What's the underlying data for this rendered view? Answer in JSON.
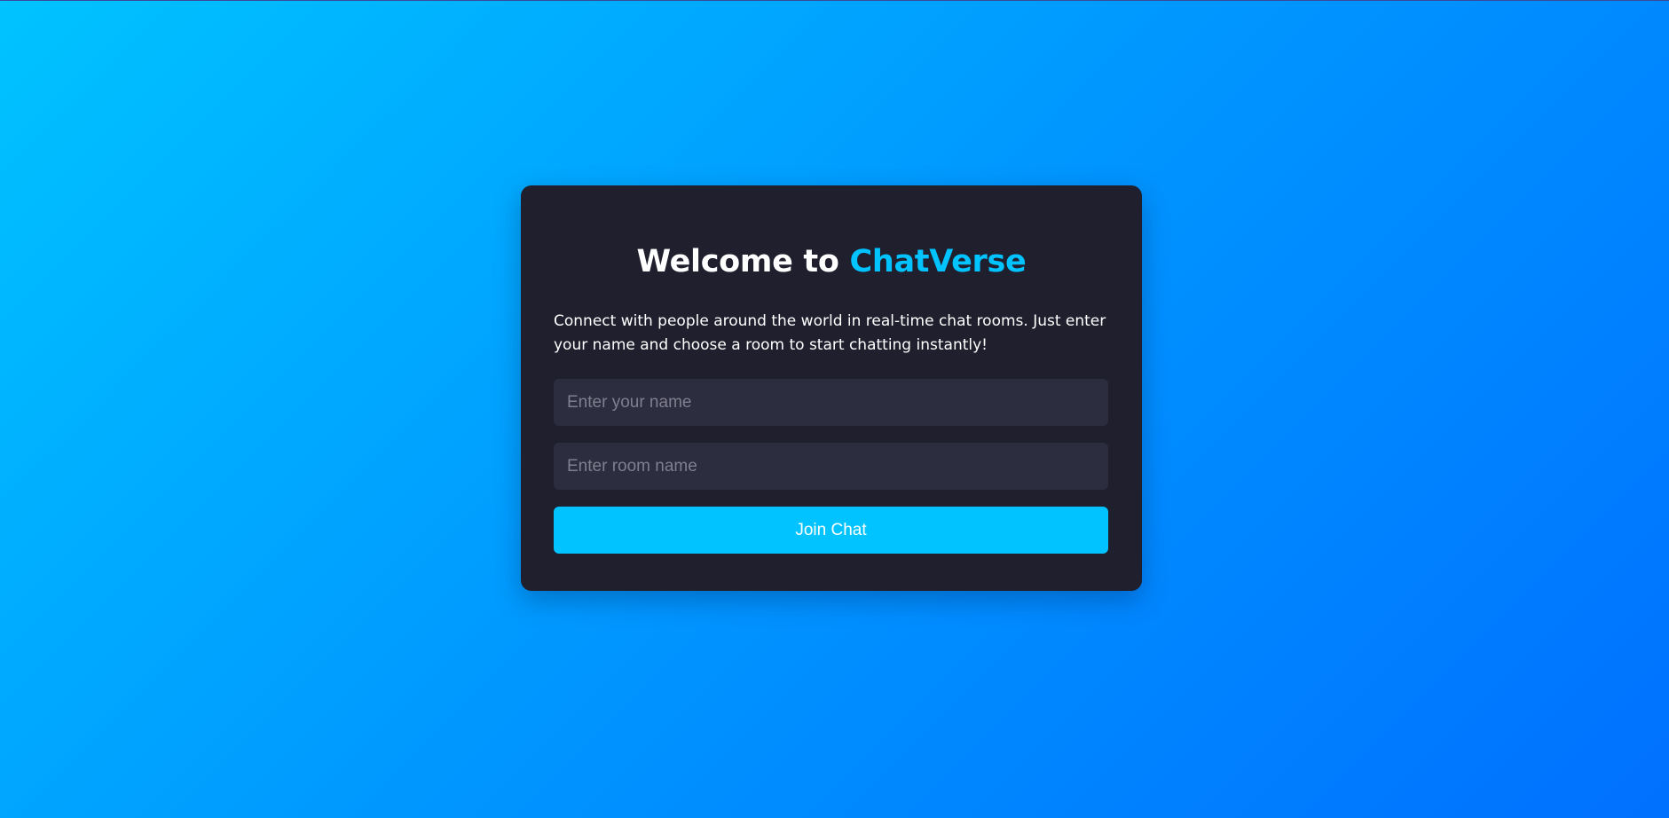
{
  "welcome": {
    "title_prefix": "Welcome to ",
    "brand_name": "ChatVerse",
    "description": "Connect with people around the world in real-time chat rooms. Just enter your name and choose a room to start chatting instantly!"
  },
  "form": {
    "name_placeholder": "Enter your name",
    "name_value": "",
    "room_placeholder": "Enter room name",
    "room_value": "",
    "join_label": "Join Chat"
  },
  "colors": {
    "background_start": "#00c3ff",
    "background_end": "#0070ff",
    "card": "#1f1f2e",
    "input": "#2d2d40",
    "accent": "#00c3ff",
    "text": "#ffffff"
  }
}
